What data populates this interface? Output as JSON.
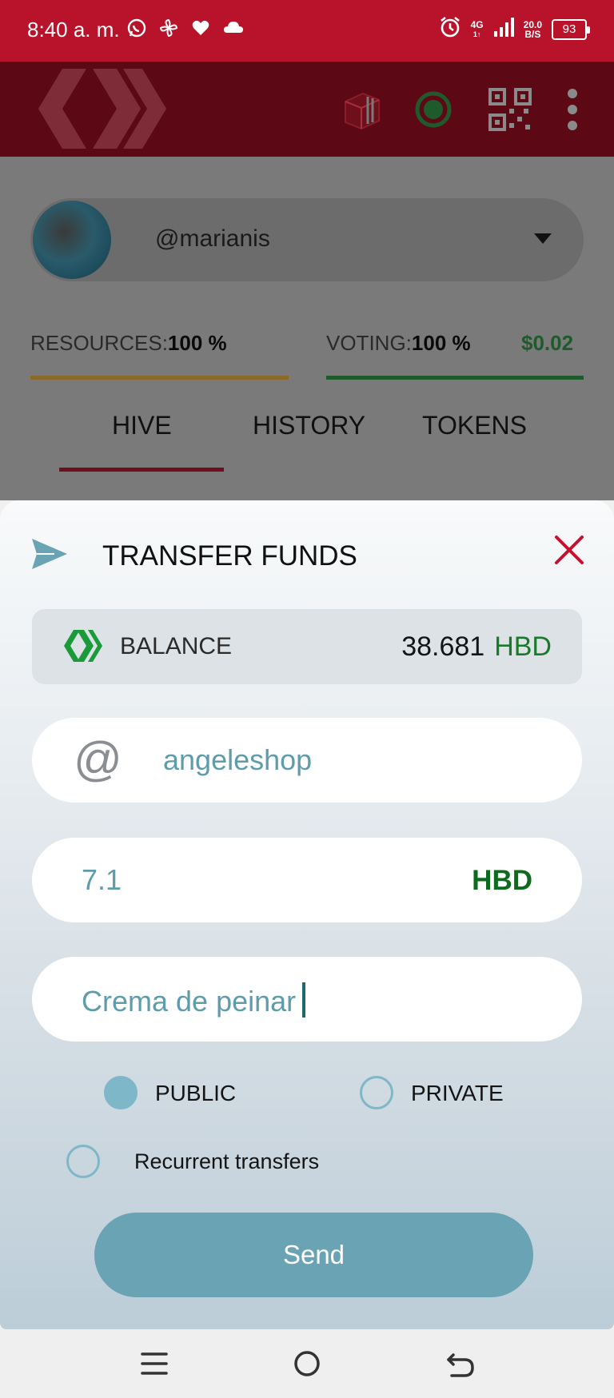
{
  "status_bar": {
    "time": "8:40 a. m.",
    "network_type": "4G",
    "network_sub": "1↑",
    "speed": "20.0",
    "speed_unit": "B/S",
    "battery": "93",
    "left_icons": [
      "whatsapp-icon",
      "pinwheel-icon",
      "heart-icon",
      "cloud-icon"
    ],
    "right_icons": [
      "alarm-icon",
      "signal-icon",
      "battery-icon"
    ]
  },
  "header": {
    "icons": [
      "hive-logo",
      "cube-icon",
      "status-dot-icon",
      "qr-code-icon",
      "more-vert-icon"
    ]
  },
  "account": {
    "name": "@marianis"
  },
  "meters": {
    "resources_label": "RESOURCES:",
    "resources_value": "100 %",
    "voting_label": "VOTING:",
    "voting_value": "100 %",
    "vote_value": "$0.02",
    "colors": {
      "resources": "#8a6a2a",
      "voting": "#1f5a2d",
      "vote_value": "#1f5a2d"
    }
  },
  "tabs": [
    {
      "label": "HIVE",
      "active": true
    },
    {
      "label": "HISTORY",
      "active": false
    },
    {
      "label": "TOKENS",
      "active": false
    }
  ],
  "modal": {
    "title": "TRANSFER FUNDS",
    "balance_label": "BALANCE",
    "balance_amount": "38.681",
    "balance_currency": "HBD",
    "to_value": "angeleshop",
    "amount_value": "7.1",
    "amount_currency": "HBD",
    "memo_value": "Crema de peinar",
    "visibility": {
      "public_label": "PUBLIC",
      "private_label": "PRIVATE",
      "selected": "public"
    },
    "recurrent_label": "Recurrent transfers",
    "recurrent_selected": false,
    "send_label": "Send",
    "colors": {
      "accent": "#69a3b4",
      "close": "#c8102e",
      "hive_green": "#1b7a2a"
    }
  },
  "nav_bar": {
    "icons": [
      "menu-icon",
      "home-icon",
      "back-icon"
    ]
  }
}
